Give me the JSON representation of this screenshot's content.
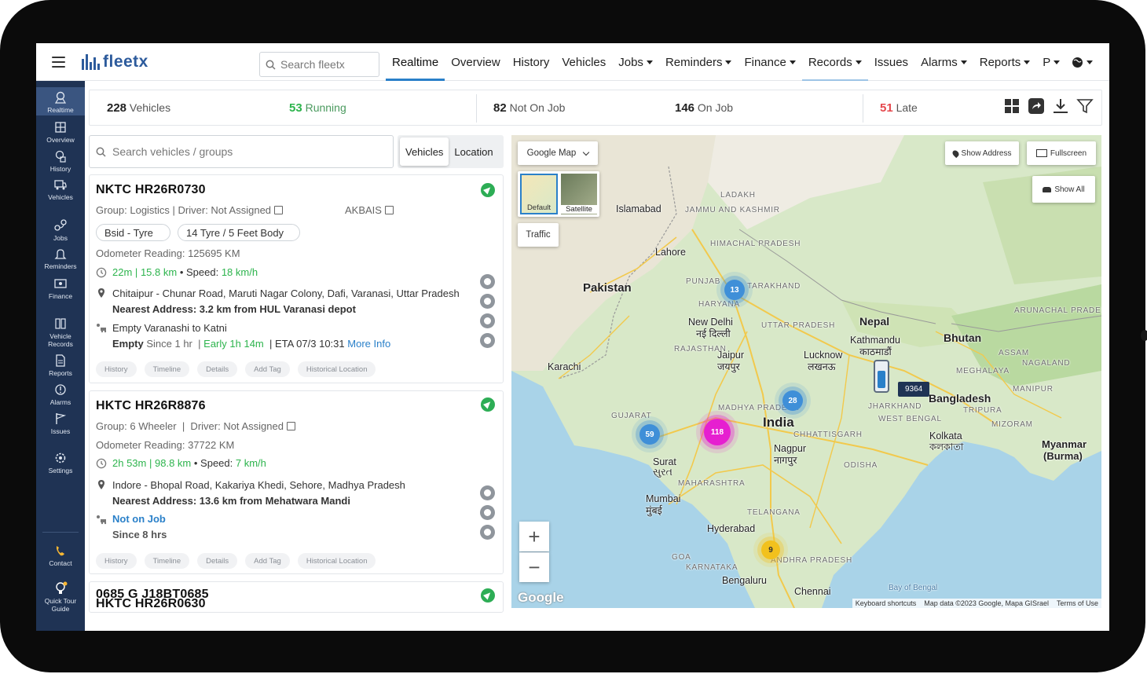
{
  "header": {
    "logo": "fleetx",
    "search_placeholder": "Search fleetx",
    "nav": [
      {
        "label": "Realtime",
        "dropdown": false
      },
      {
        "label": "Overview",
        "dropdown": false
      },
      {
        "label": "History",
        "dropdown": false
      },
      {
        "label": "Vehicles",
        "dropdown": false
      },
      {
        "label": "Jobs",
        "dropdown": true
      },
      {
        "label": "Reminders",
        "dropdown": true
      },
      {
        "label": "Finance",
        "dropdown": true
      },
      {
        "label": "Records",
        "dropdown": true
      },
      {
        "label": "Issues",
        "dropdown": false
      },
      {
        "label": "Alarms",
        "dropdown": true
      },
      {
        "label": "Reports",
        "dropdown": true
      },
      {
        "label": "P",
        "dropdown": true
      }
    ]
  },
  "sidebar": {
    "items": [
      {
        "label": "Realtime",
        "icon": "map-pin-icon"
      },
      {
        "label": "Overview",
        "icon": "overview-icon"
      },
      {
        "label": "History",
        "icon": "history-icon"
      },
      {
        "label": "Vehicles",
        "icon": "truck-icon"
      },
      {
        "label": "Jobs",
        "icon": "jobs-icon"
      },
      {
        "label": "Reminders",
        "icon": "bell-icon"
      },
      {
        "label": "Finance",
        "icon": "finance-icon"
      },
      {
        "label": "Vehicle Records",
        "icon": "records-icon"
      },
      {
        "label": "Reports",
        "icon": "reports-icon"
      },
      {
        "label": "Alarms",
        "icon": "alarm-icon"
      },
      {
        "label": "Issues",
        "icon": "flag-icon"
      },
      {
        "label": "Settings",
        "icon": "gear-icon"
      },
      {
        "label": "Contact",
        "icon": "phone-icon"
      },
      {
        "label": "Quick Tour Guide",
        "icon": "bulb-icon"
      }
    ]
  },
  "summary": {
    "total_count": "228",
    "total_label": "Vehicles",
    "running_count": "53",
    "running_label": "Running",
    "not_on_job_count": "82",
    "not_on_job_label": "Not On Job",
    "on_job_count": "146",
    "on_job_label": "On Job",
    "late_count": "51",
    "late_label": "Late"
  },
  "vehicle_panel": {
    "search_placeholder": "Search vehicles / groups",
    "tabs": [
      "Vehicles",
      "Location"
    ]
  },
  "vehicles": [
    {
      "name": "NKTC HR26R0730",
      "group_line": "Group: Logistics | Driver: Not Assigned",
      "extra": "АKBAIS",
      "pills": [
        "Bsid - Tyre",
        "14 Tyre / 5 Feet Body"
      ],
      "odometer": "Odometer Reading: 125695 KM",
      "duration": "22m",
      "distance": "15.8 km",
      "speed_label": "• Speed:",
      "speed": "18 km/h",
      "address": "Chitaipur - Chunar Road, Maruti Nagar Colony, Dafi, Varanasi, Uttar Pradesh",
      "nearest": "Nearest Address: 3.2 km from HUL Varanasi depot",
      "job": "Empty Varanashi to Katni",
      "job_status": "Empty",
      "job_since": "Since 1 hr",
      "job_early": "Early 1h 14m",
      "job_eta": "| ETA 07/3 10:31",
      "more_info": "More Info",
      "tags": [
        "History",
        "Timeline",
        "Details",
        "Add Tag",
        "Historical Location"
      ]
    },
    {
      "name": "HKTC HR26R8876",
      "group_line": "Group: 6 Wheeler  |  Driver: Not Assigned",
      "odometer": "Odometer Reading: 37722 KM",
      "duration": "2h 53m",
      "distance": "98.8 km",
      "speed_label": "• Speed:",
      "speed": "7 km/h",
      "address": "Indore - Bhopal Road, Kakariya Khedi, Sehore, Madhya Pradesh",
      "nearest": "Nearest Address: 13.6 km from Mehatwara Mandi",
      "job_status": "Not on Job",
      "job_since": "Since 8 hrs",
      "tags": [
        "History",
        "Timeline",
        "Details",
        "Add Tag",
        "Historical Location"
      ]
    },
    {
      "name": "0685 G J18BT0685",
      "name2": "HKTC HR26R0630"
    }
  ],
  "map": {
    "type_label": "Google Map",
    "layer_default": "Default",
    "layer_satellite": "Satellite",
    "traffic": "Traffic",
    "show_address": "Show Address",
    "fullscreen": "Fullscreen",
    "show_all": "Show All",
    "vehicle_tag": "9364",
    "clusters": [
      {
        "count": "13",
        "color": "#3f8fd8"
      },
      {
        "count": "28",
        "color": "#3f8fd8"
      },
      {
        "count": "59",
        "color": "#3f8fd8"
      },
      {
        "count": "118",
        "color": "#e61fd0"
      },
      {
        "count": "9",
        "color": "#f2c11d"
      }
    ],
    "labels": {
      "pakistan": "Pakistan",
      "india": "India",
      "nepal": "Nepal",
      "bhutan": "Bhutan",
      "bangladesh": "Bangladesh",
      "myanmar": "Myanmar",
      "burma": "(Burma)",
      "islamabad": "Islamabad",
      "lahore": "Lahore",
      "new_delhi": "New Delhi",
      "new_delhi_hi": "नई दिल्ली",
      "karachi": "Karachi",
      "jaipur": "Jaipur",
      "jaipur_hi": "जयपुर",
      "lucknow": "Lucknow",
      "lucknow_hi": "लखनऊ",
      "kathmandu": "Kathmandu",
      "kathmandu_ne": "काठमाडौं",
      "kolkata": "Kolkata",
      "kolkata_bn": "কলকাতা",
      "nagpur": "Nagpur",
      "nagpur_hi": "नागपुर",
      "surat": "Surat",
      "surat_gu": "સુરત",
      "mumbai": "Mumbai",
      "mumbai_hi": "मुंबई",
      "hyderabad": "Hyderabad",
      "bengaluru": "Bengaluru",
      "chennai": "Chennai",
      "ladakh": "LADAKH",
      "jammu": "JAMMU AND KASHMIR",
      "himachal": "HIMACHAL PRADESH",
      "punjab": "PUNJAB",
      "haryana": "HARYANA",
      "uttarakhand": "TARAKHAND",
      "rajasthan": "RAJASTHAN",
      "uttar_pradesh": "UTTAR PRADESH",
      "madhya_pradesh": "MADHYA PRADESH",
      "gujarat": "GUJARAT",
      "maharashtra": "MAHARASHTRA",
      "chhattisgarh": "CHHATTISGARH",
      "odisha": "ODISHA",
      "jharkhand": "JHARKHAND",
      "west_bengal": "WEST BENGAL",
      "telangana": "TELANGANA",
      "karnataka": "KARNATAKA",
      "andhra": "ANDHRA PRADESH",
      "goa": "GOA",
      "assam": "ASSAM",
      "meghalaya": "MEGHALAYA",
      "nagaland": "NAGALAND",
      "manipur": "MANIPUR",
      "tripura": "TRIPURA",
      "mizoram": "MIZORAM",
      "arunachal": "ARUNACHAL PRADESH",
      "bay_of_bengal": "Bay of Bengal"
    },
    "attribution": [
      "Keyboard shortcuts",
      "Map data ©2023 Google, Mapa GISrael",
      "Terms of Use"
    ],
    "google": "Google"
  }
}
